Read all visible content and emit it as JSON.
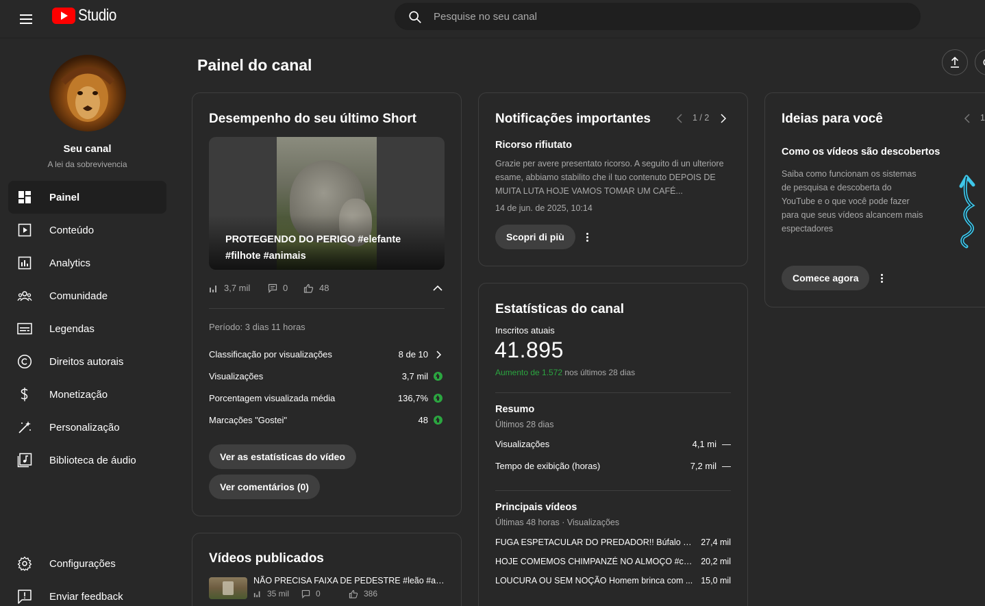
{
  "app": {
    "logo_text": "Studio"
  },
  "search": {
    "placeholder": "Pesquise no seu canal"
  },
  "sidebar": {
    "channel_name": "Seu canal",
    "channel_subtitle": "A lei da sobrevivencia",
    "items": [
      {
        "label": "Painel",
        "icon": "dashboard-icon",
        "active": true
      },
      {
        "label": "Conteúdo",
        "icon": "content-icon"
      },
      {
        "label": "Analytics",
        "icon": "analytics-icon"
      },
      {
        "label": "Comunidade",
        "icon": "community-icon"
      },
      {
        "label": "Legendas",
        "icon": "subtitles-icon"
      },
      {
        "label": "Direitos autorais",
        "icon": "copyright-icon"
      },
      {
        "label": "Monetização",
        "icon": "monetization-icon"
      },
      {
        "label": "Personalização",
        "icon": "customization-icon"
      },
      {
        "label": "Biblioteca de áudio",
        "icon": "audio-library-icon"
      }
    ],
    "bottom_items": [
      {
        "label": "Configurações",
        "icon": "settings-icon"
      },
      {
        "label": "Enviar feedback",
        "icon": "feedback-icon"
      }
    ]
  },
  "main": {
    "page_title": "Painel do canal"
  },
  "short_card": {
    "title": "Desempenho do seu último Short",
    "video_title": "PROTEGENDO DO PERIGO #elefante #filhote #animais",
    "views": "3,7 mil",
    "comments": "0",
    "likes": "48",
    "period": "Período: 3 dias 11 horas",
    "metrics": [
      {
        "label": "Classificação por visualizações",
        "value": "8 de 10"
      },
      {
        "label": "Visualizações",
        "value": "3,7 mil"
      },
      {
        "label": "Porcentagem visualizada média",
        "value": "136,7%"
      },
      {
        "label": "Marcações \"Gostei\"",
        "value": "48"
      }
    ],
    "btn_stats": "Ver as estatísticas do vídeo",
    "btn_comments": "Ver comentários (0)"
  },
  "published_card": {
    "title": "Vídeos publicados",
    "video_title": "NÃO PRECISA FAIXA DE PEDESTRE #leão #animais",
    "views": "35 mil",
    "comments": "0",
    "likes": "386"
  },
  "notifications": {
    "title": "Notificações importantes",
    "pager": "1 / 2",
    "item_title": "Ricorso rifiutato",
    "item_body": "Grazie per avere presentato ricorso. A seguito di un ulteriore esame, abbiamo stabilito che il tuo contenuto DEPOIS DE MUITA LUTA HOJE VAMOS TOMAR UM CAFÉ...",
    "item_date": "14 de jun. de 2025, 10:14",
    "button": "Scopri di più"
  },
  "channel_stats": {
    "title": "Estatísticas do canal",
    "subs_label": "Inscritos atuais",
    "subs_value": "41.895",
    "growth_highlight": "Aumento de 1.572",
    "growth_rest": "nos últimos 28 dias",
    "summary_title": "Resumo",
    "summary_sub": "Últimos 28 dias",
    "summary_rows": [
      {
        "label": "Visualizações",
        "value": "4,1 mi",
        "trend": "—"
      },
      {
        "label": "Tempo de exibição (horas)",
        "value": "7,2 mil",
        "trend": "—"
      }
    ],
    "top_title": "Principais vídeos",
    "top_sub": "Últimas 48 horas · Visualizações",
    "top_videos": [
      {
        "title": "FUGA ESPETACULAR DO PREDADOR!! Búfalo Cr...",
        "views": "27,4 mil"
      },
      {
        "title": "HOJE COMEMOS CHIMPANZÉ NO ALMOÇO #ch...",
        "views": "20,2 mil"
      },
      {
        "title": "LOUCURA OU SEM NOÇÃO Homem brinca com ...",
        "views": "15,0 mil"
      }
    ]
  },
  "ideas": {
    "title": "Ideias para você",
    "pager": "1",
    "item_title": "Como os vídeos são descobertos",
    "item_body": "Saiba como funcionam os sistemas de pesquisa e descoberta do YouTube e o que você pode fazer para que seus vídeos alcancem mais espectadores",
    "button": "Comece agora"
  },
  "colors": {
    "accent_red": "#ff0000",
    "growth_green": "#2ba640",
    "up_green": "#2ba640",
    "card_border": "#3e3e3e"
  }
}
